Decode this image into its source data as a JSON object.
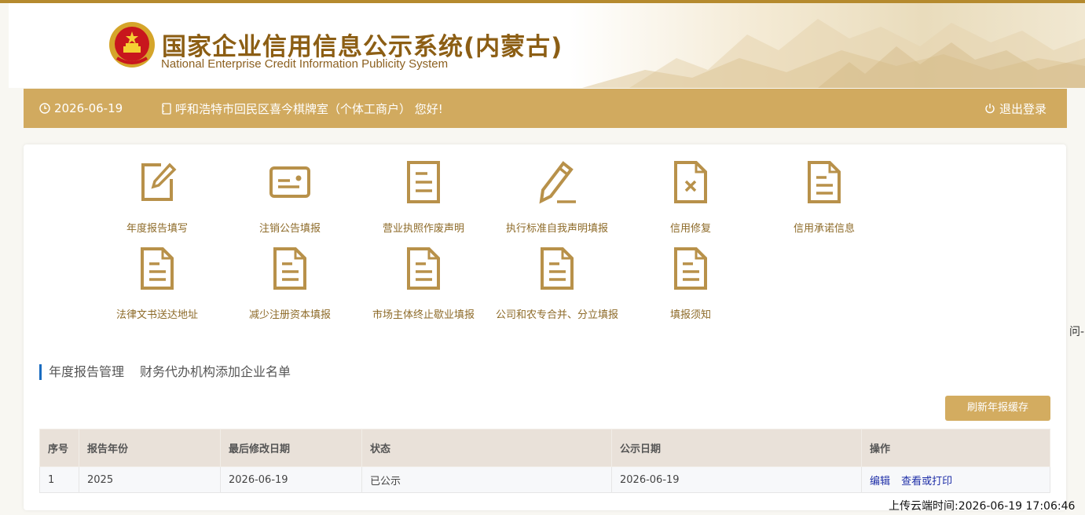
{
  "header": {
    "title_cn": "国家企业信用信息公示系统(内蒙古)",
    "title_en": "National Enterprise Credit Information Publicity System",
    "emblem_icon": "national-emblem-icon"
  },
  "navbar": {
    "date": "2026-06-19",
    "greeting": "呼和浩特市回民区喜今棋牌室（个体工商户） 您好!",
    "logout": "退出登录",
    "clock_icon": "clock-icon",
    "user_icon": "user-icon",
    "power_icon": "power-icon"
  },
  "functions": [
    {
      "label": "年度报告填写",
      "icon": "edit-icon"
    },
    {
      "label": "注销公告填报",
      "icon": "card-icon"
    },
    {
      "label": "营业执照作废声明",
      "icon": "document-icon"
    },
    {
      "label": "执行标准自我声明填报",
      "icon": "pen-icon"
    },
    {
      "label": "信用修复",
      "icon": "document-x-icon"
    },
    {
      "label": "信用承诺信息",
      "icon": "document-icon"
    },
    {
      "label": "法律文书送达地址",
      "icon": "document-icon"
    },
    {
      "label": "减少注册资本填报",
      "icon": "document-icon"
    },
    {
      "label": "市场主体终止歇业填报",
      "icon": "document-icon"
    },
    {
      "label": "公司和农专合并、分立填报",
      "icon": "document-icon"
    },
    {
      "label": "填报须知",
      "icon": "document-icon"
    }
  ],
  "tabs": [
    "年度报告管理",
    "财务代办机构添加企业名单"
  ],
  "refresh_button": "刷新年报缓存",
  "table": {
    "headers": [
      "序号",
      "报告年份",
      "最后修改日期",
      "状态",
      "公示日期",
      "操作"
    ],
    "rows": [
      {
        "index": "1",
        "year": "2025",
        "modified": "2026-06-19",
        "status": "已公示",
        "publish_date": "2026-06-19",
        "actions": [
          "编辑",
          "查看或打印"
        ]
      }
    ]
  },
  "side_text": "问-",
  "upload_time": "上传云端时间:2026-06-19 17:06:46",
  "colors": {
    "accent": "#d1aa5f",
    "title": "#8c5e14",
    "tab_bar": "#1a6cc0",
    "link": "#1f2fa8"
  }
}
